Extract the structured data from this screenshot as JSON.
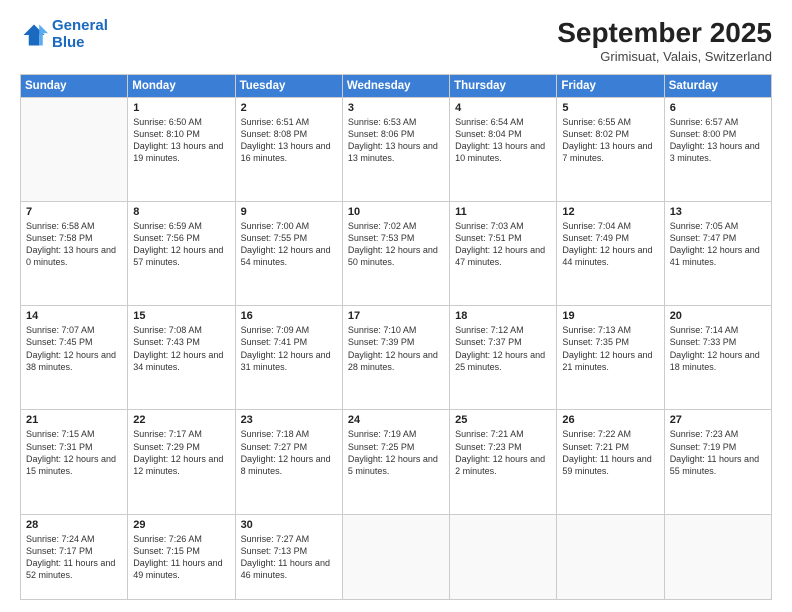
{
  "logo": {
    "text_general": "General",
    "text_blue": "Blue"
  },
  "header": {
    "month_title": "September 2025",
    "location": "Grimisuat, Valais, Switzerland"
  },
  "weekdays": [
    "Sunday",
    "Monday",
    "Tuesday",
    "Wednesday",
    "Thursday",
    "Friday",
    "Saturday"
  ],
  "weeks": [
    [
      {
        "day": "",
        "empty": true
      },
      {
        "day": "1",
        "sunrise": "Sunrise: 6:50 AM",
        "sunset": "Sunset: 8:10 PM",
        "daylight": "Daylight: 13 hours and 19 minutes."
      },
      {
        "day": "2",
        "sunrise": "Sunrise: 6:51 AM",
        "sunset": "Sunset: 8:08 PM",
        "daylight": "Daylight: 13 hours and 16 minutes."
      },
      {
        "day": "3",
        "sunrise": "Sunrise: 6:53 AM",
        "sunset": "Sunset: 8:06 PM",
        "daylight": "Daylight: 13 hours and 13 minutes."
      },
      {
        "day": "4",
        "sunrise": "Sunrise: 6:54 AM",
        "sunset": "Sunset: 8:04 PM",
        "daylight": "Daylight: 13 hours and 10 minutes."
      },
      {
        "day": "5",
        "sunrise": "Sunrise: 6:55 AM",
        "sunset": "Sunset: 8:02 PM",
        "daylight": "Daylight: 13 hours and 7 minutes."
      },
      {
        "day": "6",
        "sunrise": "Sunrise: 6:57 AM",
        "sunset": "Sunset: 8:00 PM",
        "daylight": "Daylight: 13 hours and 3 minutes."
      }
    ],
    [
      {
        "day": "7",
        "sunrise": "Sunrise: 6:58 AM",
        "sunset": "Sunset: 7:58 PM",
        "daylight": "Daylight: 13 hours and 0 minutes."
      },
      {
        "day": "8",
        "sunrise": "Sunrise: 6:59 AM",
        "sunset": "Sunset: 7:56 PM",
        "daylight": "Daylight: 12 hours and 57 minutes."
      },
      {
        "day": "9",
        "sunrise": "Sunrise: 7:00 AM",
        "sunset": "Sunset: 7:55 PM",
        "daylight": "Daylight: 12 hours and 54 minutes."
      },
      {
        "day": "10",
        "sunrise": "Sunrise: 7:02 AM",
        "sunset": "Sunset: 7:53 PM",
        "daylight": "Daylight: 12 hours and 50 minutes."
      },
      {
        "day": "11",
        "sunrise": "Sunrise: 7:03 AM",
        "sunset": "Sunset: 7:51 PM",
        "daylight": "Daylight: 12 hours and 47 minutes."
      },
      {
        "day": "12",
        "sunrise": "Sunrise: 7:04 AM",
        "sunset": "Sunset: 7:49 PM",
        "daylight": "Daylight: 12 hours and 44 minutes."
      },
      {
        "day": "13",
        "sunrise": "Sunrise: 7:05 AM",
        "sunset": "Sunset: 7:47 PM",
        "daylight": "Daylight: 12 hours and 41 minutes."
      }
    ],
    [
      {
        "day": "14",
        "sunrise": "Sunrise: 7:07 AM",
        "sunset": "Sunset: 7:45 PM",
        "daylight": "Daylight: 12 hours and 38 minutes."
      },
      {
        "day": "15",
        "sunrise": "Sunrise: 7:08 AM",
        "sunset": "Sunset: 7:43 PM",
        "daylight": "Daylight: 12 hours and 34 minutes."
      },
      {
        "day": "16",
        "sunrise": "Sunrise: 7:09 AM",
        "sunset": "Sunset: 7:41 PM",
        "daylight": "Daylight: 12 hours and 31 minutes."
      },
      {
        "day": "17",
        "sunrise": "Sunrise: 7:10 AM",
        "sunset": "Sunset: 7:39 PM",
        "daylight": "Daylight: 12 hours and 28 minutes."
      },
      {
        "day": "18",
        "sunrise": "Sunrise: 7:12 AM",
        "sunset": "Sunset: 7:37 PM",
        "daylight": "Daylight: 12 hours and 25 minutes."
      },
      {
        "day": "19",
        "sunrise": "Sunrise: 7:13 AM",
        "sunset": "Sunset: 7:35 PM",
        "daylight": "Daylight: 12 hours and 21 minutes."
      },
      {
        "day": "20",
        "sunrise": "Sunrise: 7:14 AM",
        "sunset": "Sunset: 7:33 PM",
        "daylight": "Daylight: 12 hours and 18 minutes."
      }
    ],
    [
      {
        "day": "21",
        "sunrise": "Sunrise: 7:15 AM",
        "sunset": "Sunset: 7:31 PM",
        "daylight": "Daylight: 12 hours and 15 minutes."
      },
      {
        "day": "22",
        "sunrise": "Sunrise: 7:17 AM",
        "sunset": "Sunset: 7:29 PM",
        "daylight": "Daylight: 12 hours and 12 minutes."
      },
      {
        "day": "23",
        "sunrise": "Sunrise: 7:18 AM",
        "sunset": "Sunset: 7:27 PM",
        "daylight": "Daylight: 12 hours and 8 minutes."
      },
      {
        "day": "24",
        "sunrise": "Sunrise: 7:19 AM",
        "sunset": "Sunset: 7:25 PM",
        "daylight": "Daylight: 12 hours and 5 minutes."
      },
      {
        "day": "25",
        "sunrise": "Sunrise: 7:21 AM",
        "sunset": "Sunset: 7:23 PM",
        "daylight": "Daylight: 12 hours and 2 minutes."
      },
      {
        "day": "26",
        "sunrise": "Sunrise: 7:22 AM",
        "sunset": "Sunset: 7:21 PM",
        "daylight": "Daylight: 11 hours and 59 minutes."
      },
      {
        "day": "27",
        "sunrise": "Sunrise: 7:23 AM",
        "sunset": "Sunset: 7:19 PM",
        "daylight": "Daylight: 11 hours and 55 minutes."
      }
    ],
    [
      {
        "day": "28",
        "sunrise": "Sunrise: 7:24 AM",
        "sunset": "Sunset: 7:17 PM",
        "daylight": "Daylight: 11 hours and 52 minutes."
      },
      {
        "day": "29",
        "sunrise": "Sunrise: 7:26 AM",
        "sunset": "Sunset: 7:15 PM",
        "daylight": "Daylight: 11 hours and 49 minutes."
      },
      {
        "day": "30",
        "sunrise": "Sunrise: 7:27 AM",
        "sunset": "Sunset: 7:13 PM",
        "daylight": "Daylight: 11 hours and 46 minutes."
      },
      {
        "day": "",
        "empty": true
      },
      {
        "day": "",
        "empty": true
      },
      {
        "day": "",
        "empty": true
      },
      {
        "day": "",
        "empty": true
      }
    ]
  ]
}
